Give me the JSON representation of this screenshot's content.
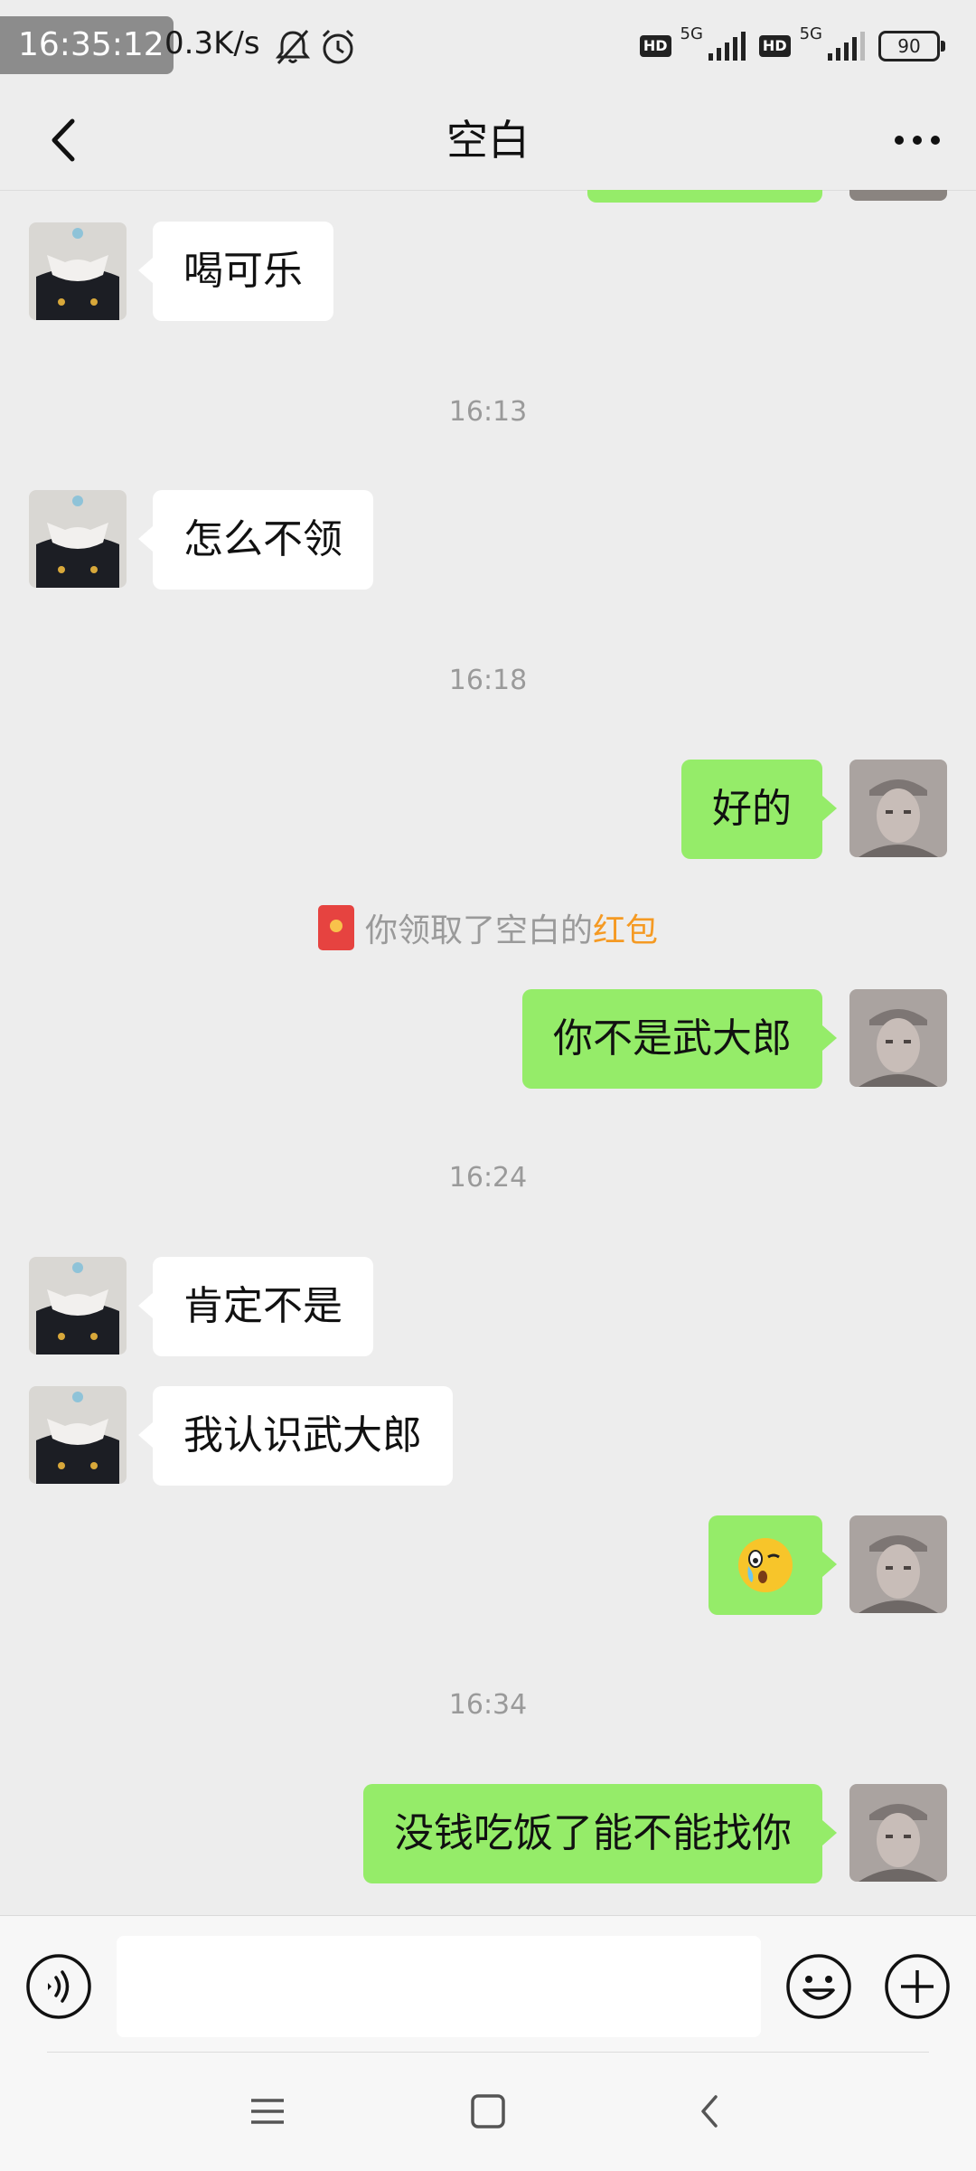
{
  "status_bar": {
    "time": "16:35:12",
    "net_speed": "0.3K/s",
    "sim1_badge": "HD",
    "sim1_network": "5G",
    "sim2_badge": "HD",
    "sim2_network": "5G",
    "battery": "90"
  },
  "header": {
    "title": "空白",
    "back_icon": "chevron-left-icon",
    "more_icon": "more-dots-icon"
  },
  "messages": [
    {
      "type": "text",
      "side": "left",
      "text": "喝可乐"
    },
    {
      "type": "time",
      "text": "16:13"
    },
    {
      "type": "text",
      "side": "left",
      "text": "怎么不领"
    },
    {
      "type": "time",
      "text": "16:18"
    },
    {
      "type": "text",
      "side": "right",
      "text": "好的"
    },
    {
      "type": "notice",
      "prefix": "你领取了空白的",
      "link": "红包"
    },
    {
      "type": "text",
      "side": "right",
      "text": "你不是武大郎"
    },
    {
      "type": "time",
      "text": "16:24"
    },
    {
      "type": "text",
      "side": "left",
      "text": "肯定不是"
    },
    {
      "type": "text",
      "side": "left",
      "text": "我认识武大郎"
    },
    {
      "type": "emoji",
      "side": "right",
      "emoji": "crying-face-emoji"
    },
    {
      "type": "time",
      "text": "16:34"
    },
    {
      "type": "text",
      "side": "right",
      "text": "没钱吃饭了能不能找你"
    }
  ],
  "input_bar": {
    "value": "",
    "voice_icon": "voice-icon",
    "emoji_icon": "smiley-icon",
    "plus_icon": "plus-icon"
  },
  "system_nav": {
    "menu_icon": "menu-icon",
    "home_icon": "home-square-icon",
    "back_icon": "back-triangle-icon"
  },
  "colors": {
    "background": "#ededed",
    "bubble_right": "#95ec69",
    "bubble_left": "#ffffff",
    "link": "#f59a23",
    "timestamp": "#9a9a9a"
  }
}
